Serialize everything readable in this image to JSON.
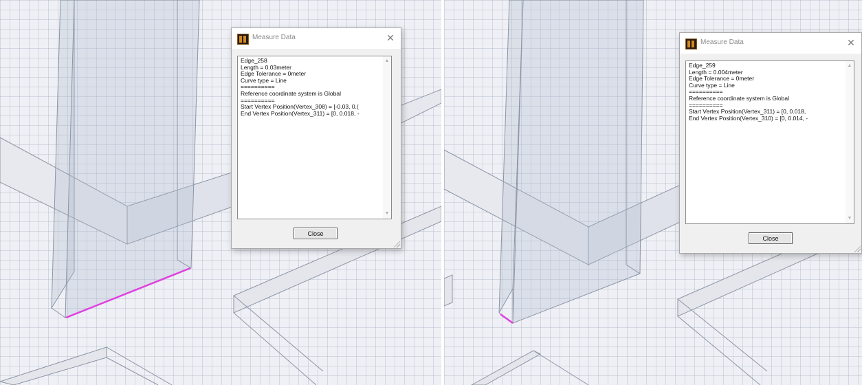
{
  "left_view": {
    "dialog": {
      "title": "Measure Data",
      "close_glyph": "✕",
      "lines": [
        "Edge_258",
        "Length = 0.03meter",
        "Edge Tolerance = 0meter",
        "Curve type = Line",
        "==========",
        "Reference coordinate system is Global",
        "==========",
        "Start Vertex Position(Vertex_308) = [-0.03, 0.(",
        "End Vertex Position(Vertex_311) = [0, 0.018, -"
      ],
      "close_button": "Close"
    },
    "highlight_color": "#e040e0"
  },
  "right_view": {
    "dialog": {
      "title": "Measure Data",
      "close_glyph": "✕",
      "lines": [
        "Edge_259",
        "Length = 0.004meter",
        "Edge Tolerance = 0meter",
        "Curve type = Line",
        "==========",
        "Reference coordinate system is Global",
        "==========",
        "Start Vertex Position(Vertex_311) = [0, 0.018,",
        "End Vertex Position(Vertex_310) = [0, 0.014, -"
      ],
      "close_button": "Close"
    },
    "highlight_color": "#e040e0"
  },
  "icons": {
    "app": "measure-app-icon",
    "scroll_up": "▲",
    "scroll_down": "▼"
  }
}
